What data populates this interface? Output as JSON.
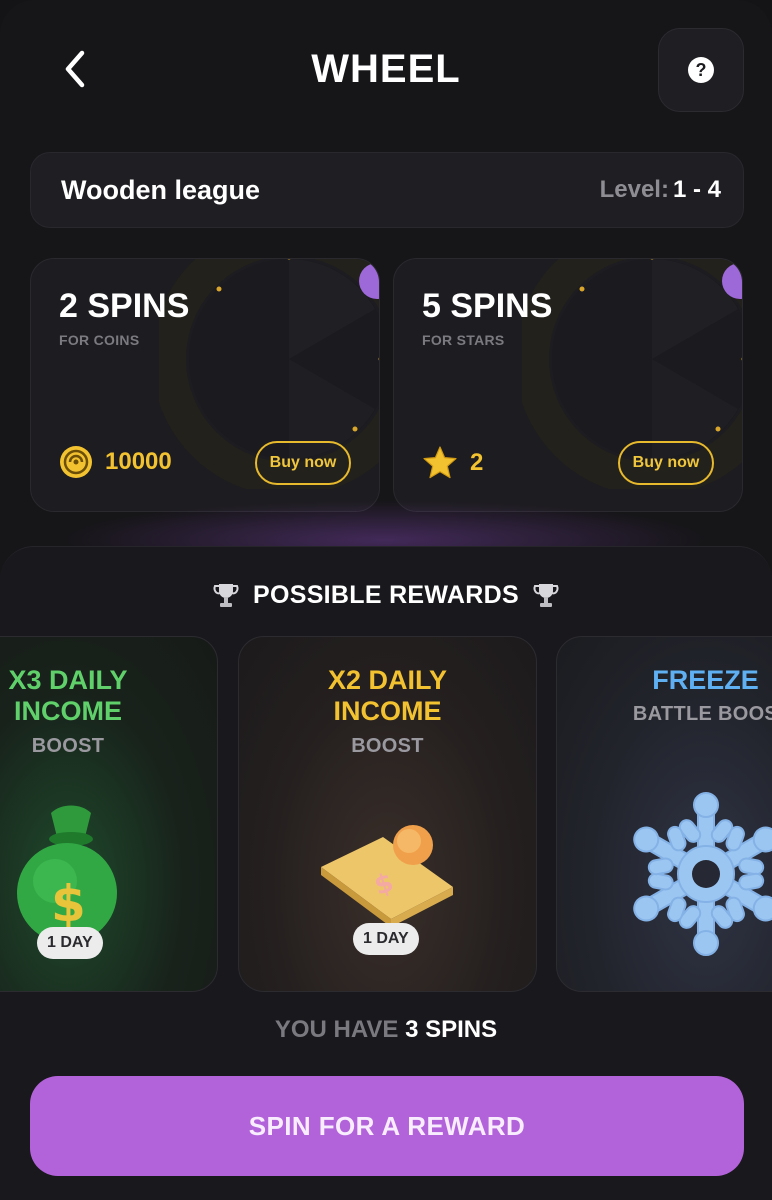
{
  "header": {
    "title": "WHEEL",
    "back_icon": "chevron-left-icon",
    "help_icon": "question-icon",
    "help_glyph": "?"
  },
  "league": {
    "name": "Wooden league",
    "level_label": "Level:",
    "level_value": "1 - 4"
  },
  "offers": [
    {
      "title": "2 SPINS",
      "subtitle": "FOR COINS",
      "price": "10000",
      "currency_icon": "coin-icon",
      "button": "Buy now"
    },
    {
      "title": "5 SPINS",
      "subtitle": "FOR STARS",
      "price": "2",
      "currency_icon": "star-icon",
      "button": "Buy now"
    }
  ],
  "rewards": {
    "heading": "POSSIBLE REWARDS",
    "items": [
      {
        "title_line1": "X3 DAILY",
        "title_line2": "INCOME",
        "subtitle": "BOOST",
        "badge": "1 DAY",
        "color": "#5fd06a",
        "icon": "money-bag-icon"
      },
      {
        "title_line1": "X2 DAILY",
        "title_line2": "INCOME",
        "subtitle": "BOOST",
        "badge": "1 DAY",
        "color": "#f2c230",
        "icon": "cash-coin-icon"
      },
      {
        "title_line1": "FREEZE",
        "title_line2": "",
        "subtitle": "BATTLE BOOS",
        "badge": "",
        "color": "#5fb0f2",
        "icon": "snowflake-icon"
      }
    ]
  },
  "spins": {
    "prefix": "YOU HAVE",
    "count_text": "3 SPINS"
  },
  "cta": {
    "label": "SPIN FOR A REWARD"
  },
  "colors": {
    "accent": "#b363da",
    "gold": "#f2c230",
    "background": "#161518"
  }
}
